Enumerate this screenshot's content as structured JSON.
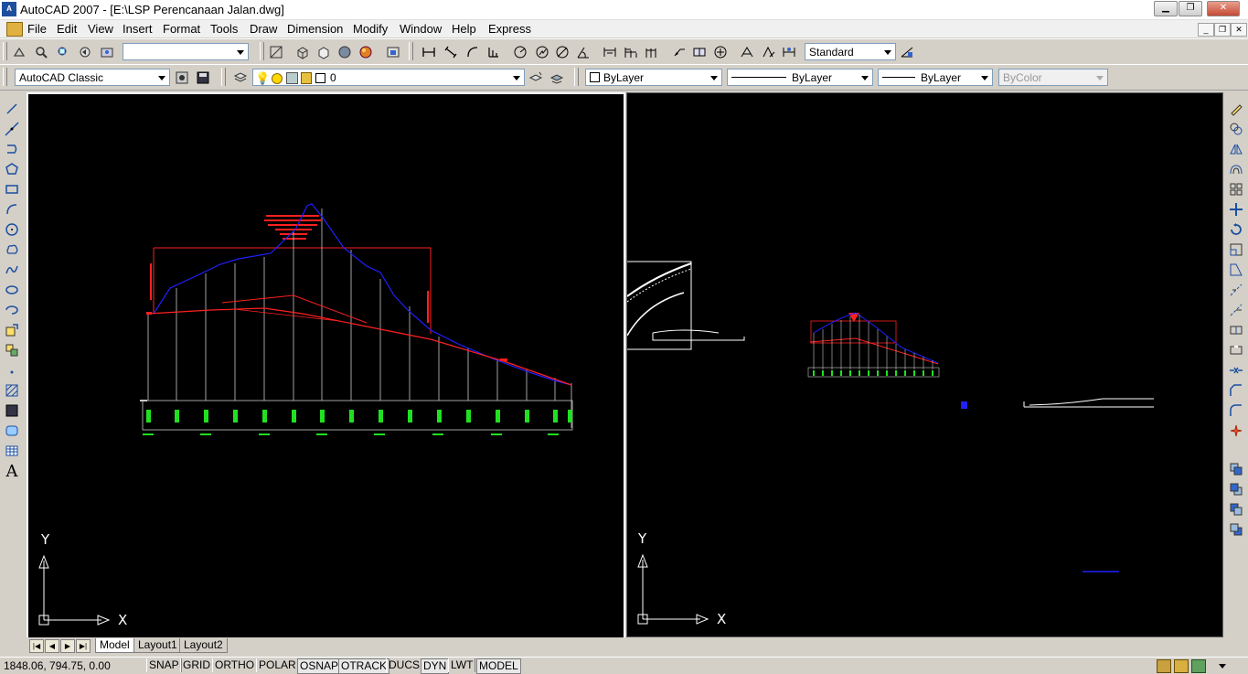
{
  "window": {
    "title": "AutoCAD 2007 - [E:\\LSP Perencanaan Jalan.dwg]",
    "app_icon": "autocad-icon",
    "controls": [
      "minimize",
      "maximize",
      "close"
    ]
  },
  "menu": {
    "items": [
      "File",
      "Edit",
      "View",
      "Insert",
      "Format",
      "Tools",
      "Draw",
      "Dimension",
      "Modify",
      "Window",
      "Help",
      "Express"
    ]
  },
  "toolbar_standard": {
    "named_view_value": "",
    "text_style_value": "Standard"
  },
  "toolbar_layers": {
    "workspace_value": "AutoCAD Classic",
    "layer_value": "0",
    "color_value": "ByLayer",
    "linetype_value": "ByLayer",
    "lineweight_value": "ByLayer",
    "plotstyle_value": "ByColor"
  },
  "viewports": {
    "left": {
      "ucs_x": "X",
      "ucs_y": "Y"
    },
    "right": {
      "ucs_x": "X",
      "ucs_y": "Y"
    }
  },
  "tabs": {
    "items": [
      "Model",
      "Layout1",
      "Layout2"
    ],
    "active": "Model"
  },
  "status": {
    "coordinates": "1848.06, 794.75, 0.00",
    "toggles": [
      "SNAP",
      "GRID",
      "ORTHO",
      "POLAR",
      "OSNAP",
      "OTRACK",
      "DUCS",
      "DYN",
      "LWT",
      "MODEL"
    ]
  },
  "colors": {
    "canvas": "#000000",
    "profile_ground": "#1a1aff",
    "profile_design": "#ff2020",
    "stations": "#00ff00",
    "chrome": "#d4d0c8"
  }
}
